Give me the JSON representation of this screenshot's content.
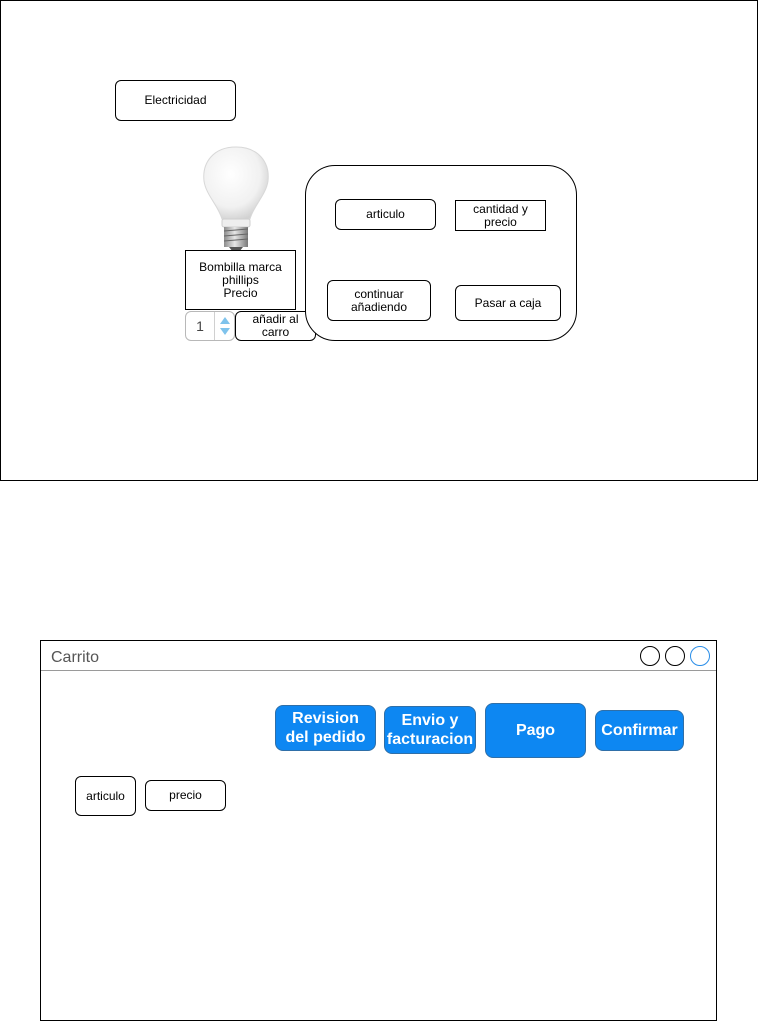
{
  "top": {
    "category_label": "Electricidad",
    "product": {
      "name_line1": "Bombilla marca",
      "name_line2": "phillips",
      "price_line": "Precio",
      "image": "light-bulb"
    },
    "quantity": "1",
    "add_to_cart_label": "añadir al carro",
    "cart_popup": {
      "item_label": "articulo",
      "qty_price_label": "cantidad y precio",
      "continue_label": "continuar añadiendo",
      "checkout_label": "Pasar a caja"
    }
  },
  "cart_window": {
    "title": "Carrito",
    "window_controls": [
      "circle-icon",
      "circle-icon",
      "circle-icon"
    ],
    "steps": [
      {
        "label": "Revision del pedido"
      },
      {
        "label": "Envio y facturacion"
      },
      {
        "label": "Pago"
      },
      {
        "label": "Confirmar"
      }
    ],
    "columns": {
      "item_label": "articulo",
      "price_label": "precio"
    }
  },
  "colors": {
    "step_fill": "#0d87f2",
    "active_control": "#2a8ee8"
  }
}
